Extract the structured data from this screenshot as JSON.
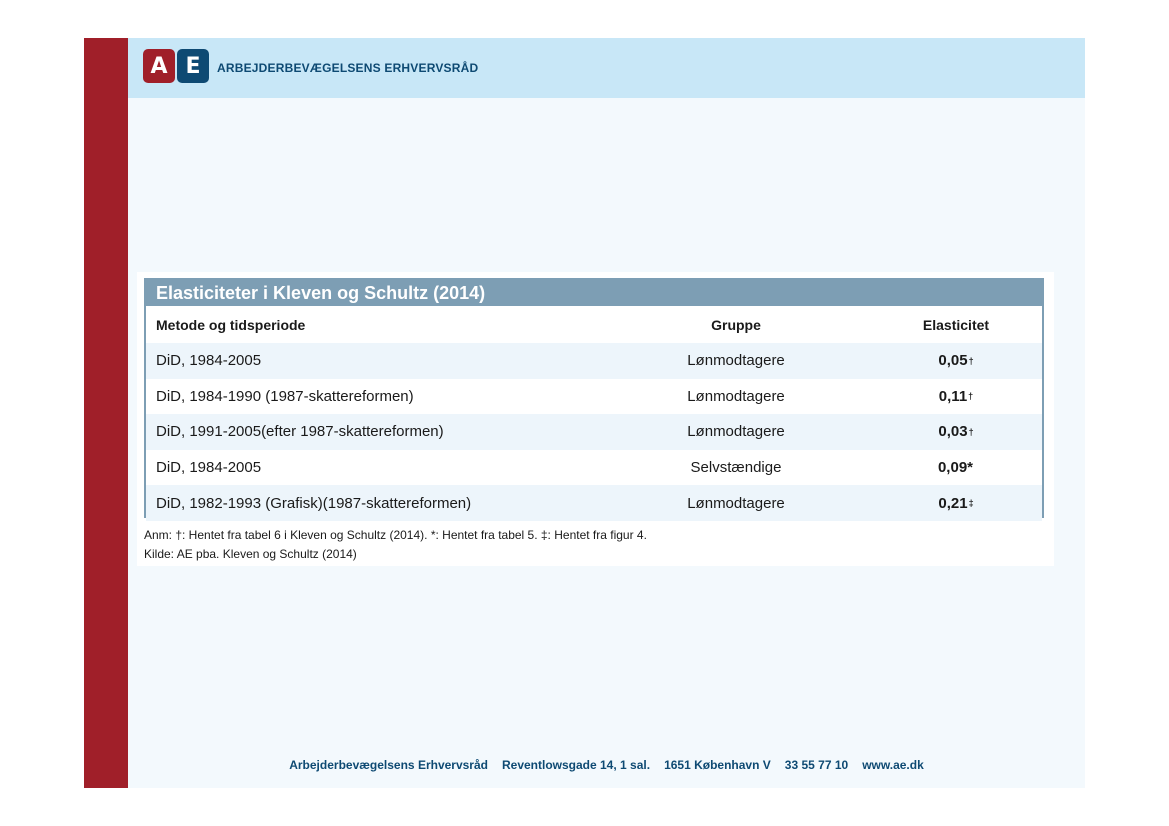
{
  "header": {
    "logo_a": "A",
    "logo_e": "E",
    "org_name": "ARBEJDERBEVÆGELSENS ERHVERVSRÅD"
  },
  "table": {
    "title": "Elasticiteter i Kleven og Schultz (2014)",
    "columns": [
      "Metode og tidsperiode",
      "Gruppe",
      "Elasticitet"
    ],
    "rows": [
      {
        "method": "DiD, 1984-2005",
        "group": "Lønmodtagere",
        "value": "0,05",
        "mark": "†"
      },
      {
        "method": "DiD, 1984-1990 (1987-skattereformen)",
        "group": "Lønmodtagere",
        "value": "0,11",
        "mark": "†"
      },
      {
        "method": "DiD, 1991-2005(efter 1987-skattereformen)",
        "group": "Lønmodtagere",
        "value": "0,03",
        "mark": "†"
      },
      {
        "method": "DiD, 1984-2005",
        "group": "Selvstændige",
        "value": "0,09*",
        "mark": ""
      },
      {
        "method": "DiD, 1982-1993 (Grafisk)(1987-skattereformen)",
        "group": "Lønmodtagere",
        "value": "0,21",
        "mark": "‡"
      }
    ],
    "note": "Anm: †: Hentet fra tabel 6 i Kleven og Schultz (2014). *: Hentet fra tabel 5. ‡: Hentet fra figur 4.",
    "source": "Kilde: AE pba. Kleven og Schultz (2014)"
  },
  "footer": {
    "org": "Arbejderbevægelsens Erhvervsråd",
    "address": "Reventlowsgade 14, 1 sal.",
    "city": "1651 København V",
    "phone": "33 55 77 10",
    "web": "www.ae.dk"
  },
  "colors": {
    "brand_red": "#a01f29",
    "brand_blue": "#0e4a73",
    "header_bg": "#c8e7f7",
    "table_accent": "#7d9eb4"
  }
}
